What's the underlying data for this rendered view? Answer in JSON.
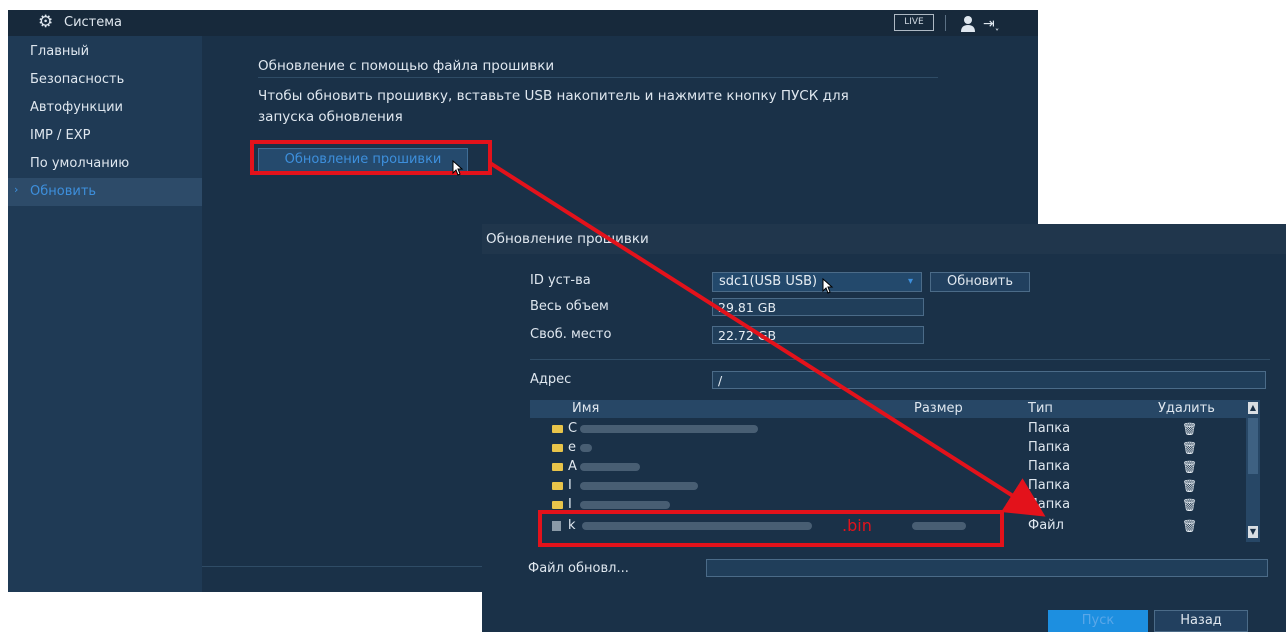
{
  "topbar": {
    "title": "Система",
    "live": "LIVE"
  },
  "sidebar": {
    "items": [
      {
        "label": "Главный"
      },
      {
        "label": "Безопасность"
      },
      {
        "label": "Автофункции"
      },
      {
        "label": "IMP / EXP"
      },
      {
        "label": "По умолчанию"
      },
      {
        "label": "Обновить",
        "active": true
      }
    ]
  },
  "content": {
    "title": "Обновление с помощью файла прошивки",
    "description": "Чтобы обновить прошивку, вставьте USB накопитель и нажмите кнопку ПУСК для запуска обновления",
    "firmware_button": "Обновление прошивки"
  },
  "dialog": {
    "title": "Обновление прошивки",
    "device_id_label": "ID уст-ва",
    "device_id_value": "sdc1(USB USB)",
    "refresh_button": "Обновить",
    "total_label": "Весь объем",
    "total_value": "29.81 GB",
    "free_label": "Своб. место",
    "free_value": "22.72 GB",
    "address_label": "Адрес",
    "address_value": "/",
    "table": {
      "columns": [
        "Имя",
        "Размер",
        "Тип",
        "Удалить"
      ],
      "rows": [
        {
          "name": "C",
          "type": "Папка"
        },
        {
          "name": "e",
          "type": "Папка"
        },
        {
          "name": "A",
          "type": "Папка"
        },
        {
          "name": "I",
          "type": "Папка"
        },
        {
          "name": "I",
          "type": "Папка"
        },
        {
          "name": "k",
          "type": "Файл"
        }
      ]
    },
    "update_file_label": "Файл обновл...",
    "start_button": "Пуск",
    "back_button": "Назад"
  },
  "annotation": {
    "bin_label": ".bin",
    "color": "#e3121b"
  },
  "colors": {
    "panel": "#1a3148",
    "sidebar": "#1f3a55",
    "accent": "#3d8fdc",
    "start": "#1d8fe0"
  }
}
